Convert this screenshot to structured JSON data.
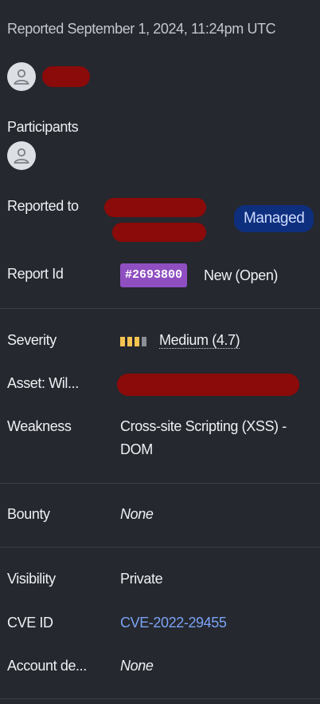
{
  "reported_line": "Reported September 1, 2024, 11:24pm UTC",
  "participants_label": "Participants",
  "reported_to_label": "Reported to",
  "reported_to_badge": "Managed",
  "report_id_label": "Report Id",
  "report_id": "#2693800",
  "report_status": "New (Open)",
  "severity": {
    "label": "Severity",
    "value": "Medium (4.7)",
    "level_filled": 3,
    "level_total": 4,
    "fill_color": "#f5c451",
    "empty_color": "#8a8f97"
  },
  "asset_label": "Asset: Wil...",
  "weakness": {
    "label": "Weakness",
    "line1": "Cross-site Scripting (XSS) -",
    "line2": "DOM"
  },
  "bounty": {
    "label": "Bounty",
    "value": "None"
  },
  "visibility": {
    "label": "Visibility",
    "value": "Private"
  },
  "cve": {
    "label": "CVE ID",
    "value": "CVE-2022-29455"
  },
  "account": {
    "label": "Account de...",
    "value": "None"
  },
  "colors": {
    "background": "#25282e",
    "redaction": "#8b0a0a",
    "badge_purple": "#8f4fc1",
    "pill_blue": "#0e2f7e",
    "link_blue": "#7ba2f5"
  }
}
